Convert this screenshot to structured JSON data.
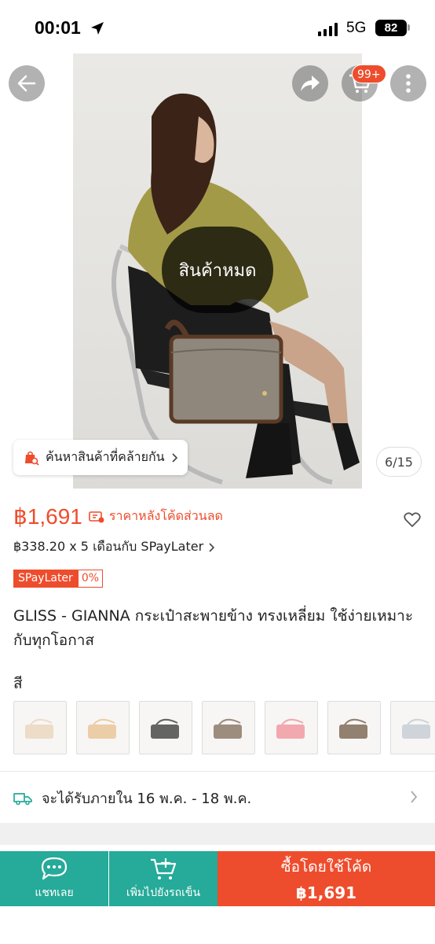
{
  "status_bar": {
    "time": "00:01",
    "network": "5G",
    "battery": "82"
  },
  "gallery": {
    "cart_badge": "99+",
    "sold_out_label": "สินค้าหมด",
    "find_similar_label": "ค้นหาสินค้าที่คล้ายกัน",
    "image_counter": "6/15"
  },
  "product": {
    "price": "฿1,691",
    "price_note": "ราคาหลังโค้ดส่วนลด",
    "installment": "฿338.20 x 5 เดือนกับ SPayLater",
    "spaylater_badge": "SPayLater",
    "spaylater_rate": "0%",
    "title": "GLISS - GIANNA กระเป๋าสะพายข้าง ทรงเหลี่ยม ใช้ง่ายเหมาะกับทุกโอกาส",
    "variation_label": "สี",
    "variations": [
      {
        "color": "#e9d6bf"
      },
      {
        "color": "#e8c59a"
      },
      {
        "color": "#4a4a48"
      },
      {
        "color": "#8b7a68"
      },
      {
        "color": "#f09aa2"
      },
      {
        "color": "#7f6a58"
      },
      {
        "color": "#c7ccd4"
      }
    ]
  },
  "delivery": {
    "text": "จะได้รับภายใน 16 พ.ค. - 18 พ.ค."
  },
  "bottom_bar": {
    "chat_label": "แชทเลย",
    "add_to_cart_label": "เพิ่มไปยังรถเข็น",
    "buy_label": "ซื้อโดยใช้โค้ด",
    "buy_price": "฿1,691"
  },
  "colors": {
    "accent": "#ee4d2d",
    "teal": "#26aa99"
  }
}
